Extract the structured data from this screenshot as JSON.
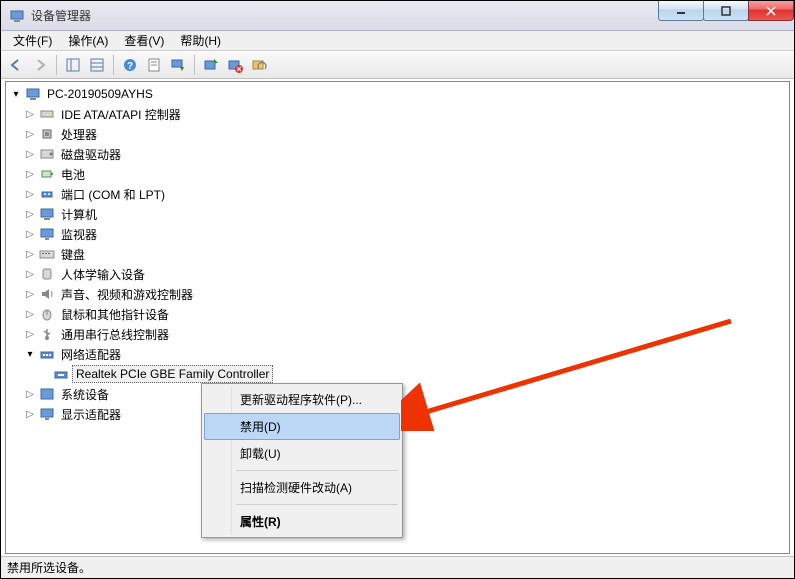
{
  "window": {
    "title": "设备管理器"
  },
  "menu": {
    "file": "文件(F)",
    "action": "操作(A)",
    "view": "查看(V)",
    "help": "帮助(H)"
  },
  "tree": {
    "root": "PC-20190509AYHS",
    "items": [
      {
        "label": "IDE ATA/ATAPI 控制器"
      },
      {
        "label": "处理器"
      },
      {
        "label": "磁盘驱动器"
      },
      {
        "label": "电池"
      },
      {
        "label": "端口 (COM 和 LPT)"
      },
      {
        "label": "计算机"
      },
      {
        "label": "监视器"
      },
      {
        "label": "键盘"
      },
      {
        "label": "人体学输入设备"
      },
      {
        "label": "声音、视频和游戏控制器"
      },
      {
        "label": "鼠标和其他指针设备"
      },
      {
        "label": "通用串行总线控制器"
      },
      {
        "label": "网络适配器",
        "expanded": true,
        "children": [
          {
            "label": "Realtek PCIe GBE Family Controller",
            "selected": true
          }
        ]
      },
      {
        "label": "系统设备"
      },
      {
        "label": "显示适配器"
      }
    ]
  },
  "context_menu": {
    "update": "更新驱动程序软件(P)...",
    "disable": "禁用(D)",
    "uninstall": "卸载(U)",
    "scan": "扫描检测硬件改动(A)",
    "properties": "属性(R)"
  },
  "statusbar": {
    "text": "禁用所选设备。"
  }
}
